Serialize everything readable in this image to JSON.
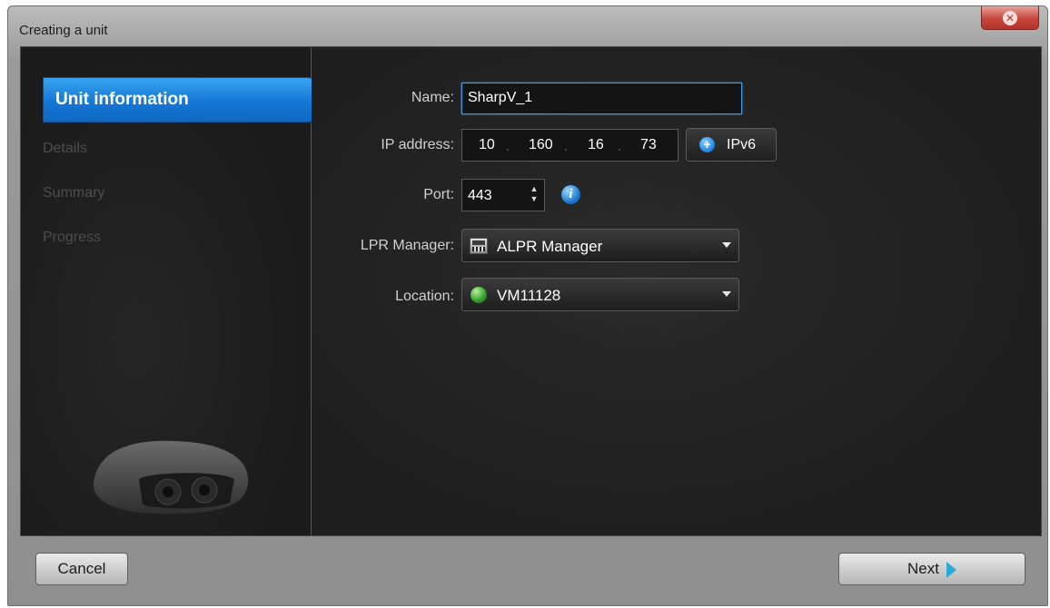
{
  "window": {
    "title": "Creating a unit"
  },
  "steps": [
    {
      "label": "Unit information",
      "active": true
    },
    {
      "label": "Details",
      "active": false
    },
    {
      "label": "Summary",
      "active": false
    },
    {
      "label": "Progress",
      "active": false
    }
  ],
  "form": {
    "name_label": "Name:",
    "name_value": "SharpV_1",
    "ip_label": "IP address:",
    "ip_octets": [
      "10",
      "160",
      "16",
      "73"
    ],
    "ipv6_button": "IPv6",
    "port_label": "Port:",
    "port_value": "443",
    "lpr_label": "LPR Manager:",
    "lpr_value": "ALPR Manager",
    "location_label": "Location:",
    "location_value": "VM11128"
  },
  "footer": {
    "cancel_label": "Cancel",
    "next_label": "Next"
  },
  "icons": {
    "close": "close-icon",
    "ipv6_add": "plus-circle-icon",
    "info": "info-icon",
    "lpr": "lpr-manager-icon",
    "location": "globe-icon",
    "next": "chevron-right-icon"
  },
  "colors": {
    "active_step": "#1577d6",
    "focus_border": "#3f9be3",
    "close_button": "#c8453c"
  }
}
